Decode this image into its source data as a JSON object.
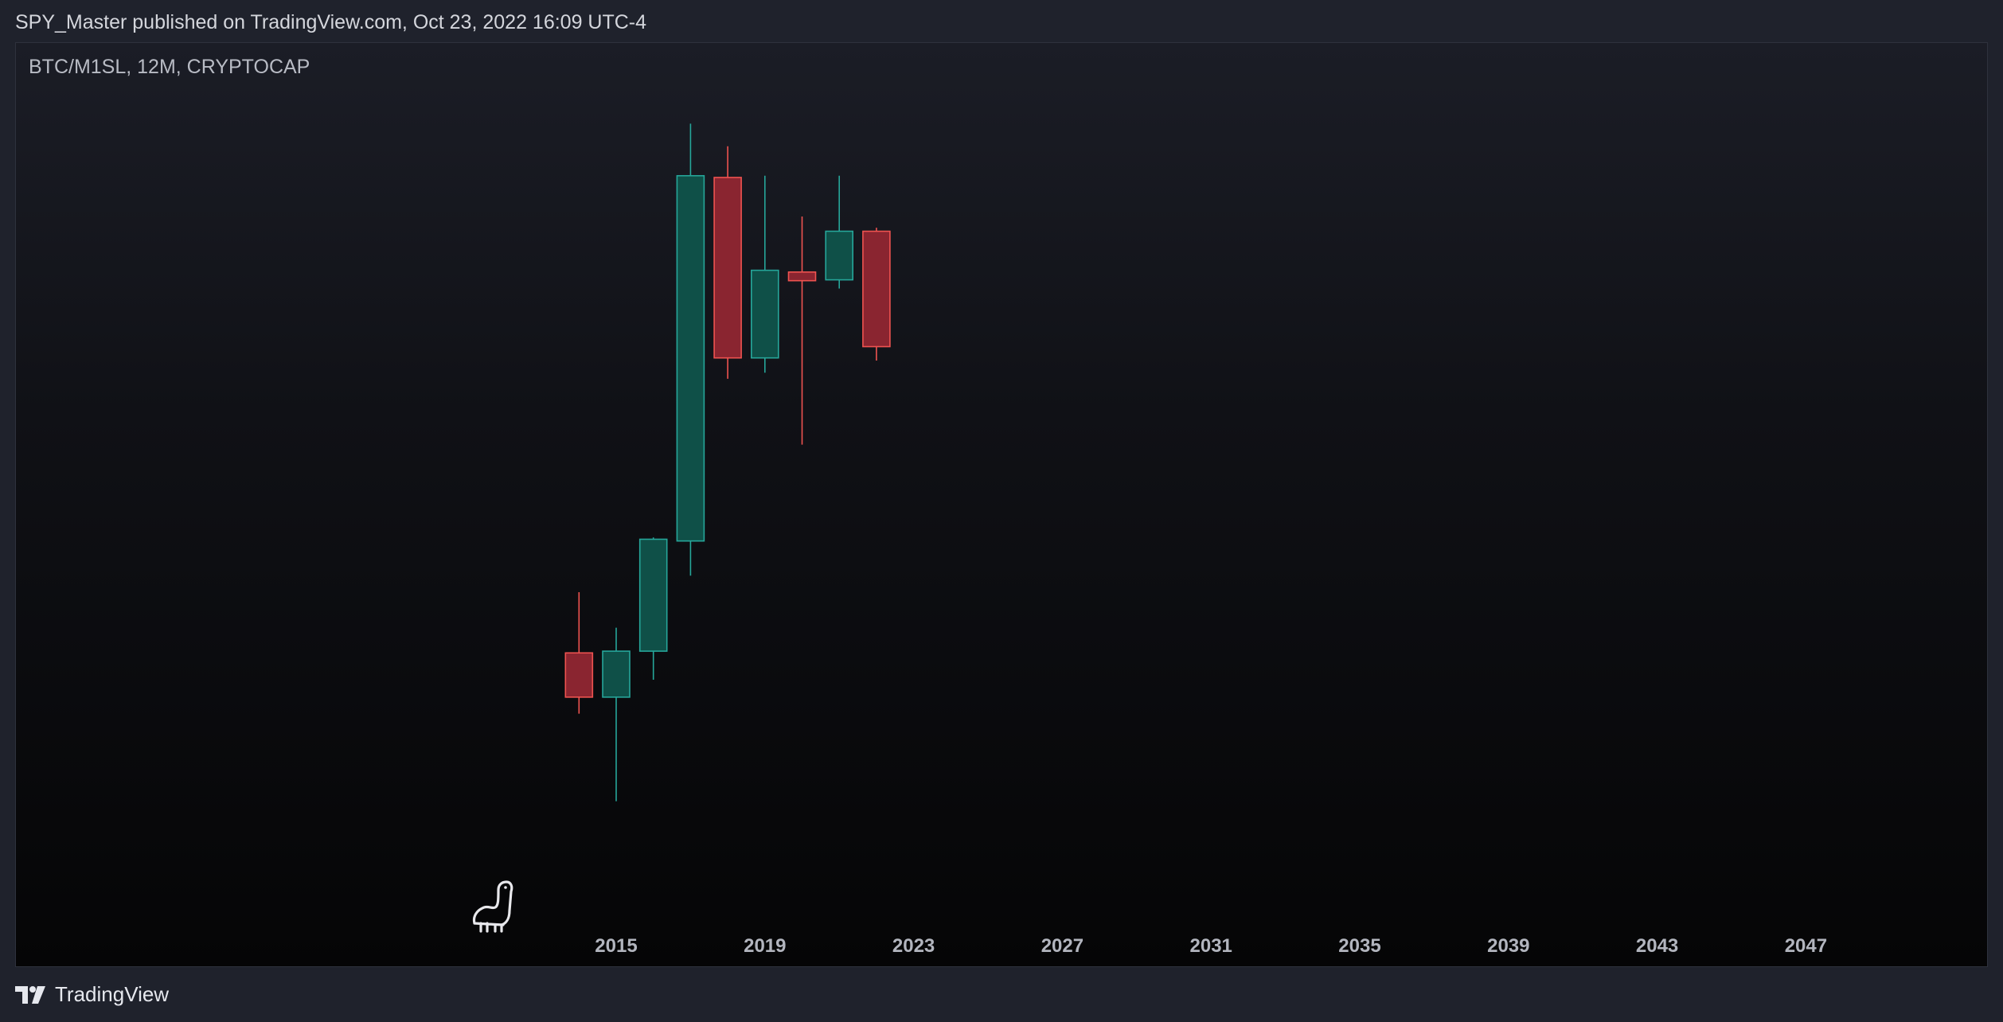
{
  "header": {
    "publisher_line": "SPY_Master published on TradingView.com, Oct 23, 2022 16:09 UTC-4"
  },
  "footer": {
    "brand": "TradingView",
    "logo_icon": "tradingview-logo-icon"
  },
  "colors": {
    "up": "#26a69a",
    "up_fill": "#0f5048",
    "down": "#ef5350",
    "down_fill": "#8a2530",
    "tick_text": "#b2b5be",
    "symbol_text": "#b8bbc4"
  },
  "chart_data": {
    "type": "candlestick",
    "title": "BTC/M1SL, 12M, CRYPTOCAP",
    "x_axis": {
      "type": "year",
      "range": [
        2008,
        2052
      ],
      "ticks": [
        "2015",
        "2019",
        "2023",
        "2027",
        "2031",
        "2035",
        "2039",
        "2043",
        "2047"
      ]
    },
    "y_axis": {
      "shown": false,
      "range": [
        0,
        100
      ],
      "note": "price scale hidden; values are relative (0 = chart bottom, 100 = chart top)"
    },
    "grid": false,
    "watermark_icon": "dinosaur-icon",
    "candles": [
      {
        "year": 2014,
        "open": 29.7,
        "high": 36.7,
        "low": 22.7,
        "close": 24.6,
        "direction": "down"
      },
      {
        "year": 2015,
        "open": 24.6,
        "high": 32.6,
        "low": 12.6,
        "close": 29.9,
        "direction": "up"
      },
      {
        "year": 2016,
        "open": 29.9,
        "high": 43.0,
        "low": 26.6,
        "close": 42.8,
        "direction": "up"
      },
      {
        "year": 2017,
        "open": 42.6,
        "high": 90.7,
        "low": 38.6,
        "close": 84.7,
        "direction": "up"
      },
      {
        "year": 2018,
        "open": 84.5,
        "high": 88.1,
        "low": 61.3,
        "close": 63.7,
        "direction": "down"
      },
      {
        "year": 2019,
        "open": 63.7,
        "high": 84.7,
        "low": 62.0,
        "close": 73.8,
        "direction": "up"
      },
      {
        "year": 2020,
        "open": 73.6,
        "high": 80.0,
        "low": 53.7,
        "close": 72.6,
        "direction": "down"
      },
      {
        "year": 2021,
        "open": 72.7,
        "high": 84.7,
        "low": 71.7,
        "close": 78.3,
        "direction": "up"
      },
      {
        "year": 2022,
        "open": 78.3,
        "high": 78.7,
        "low": 63.4,
        "close": 65.0,
        "direction": "down"
      }
    ]
  }
}
